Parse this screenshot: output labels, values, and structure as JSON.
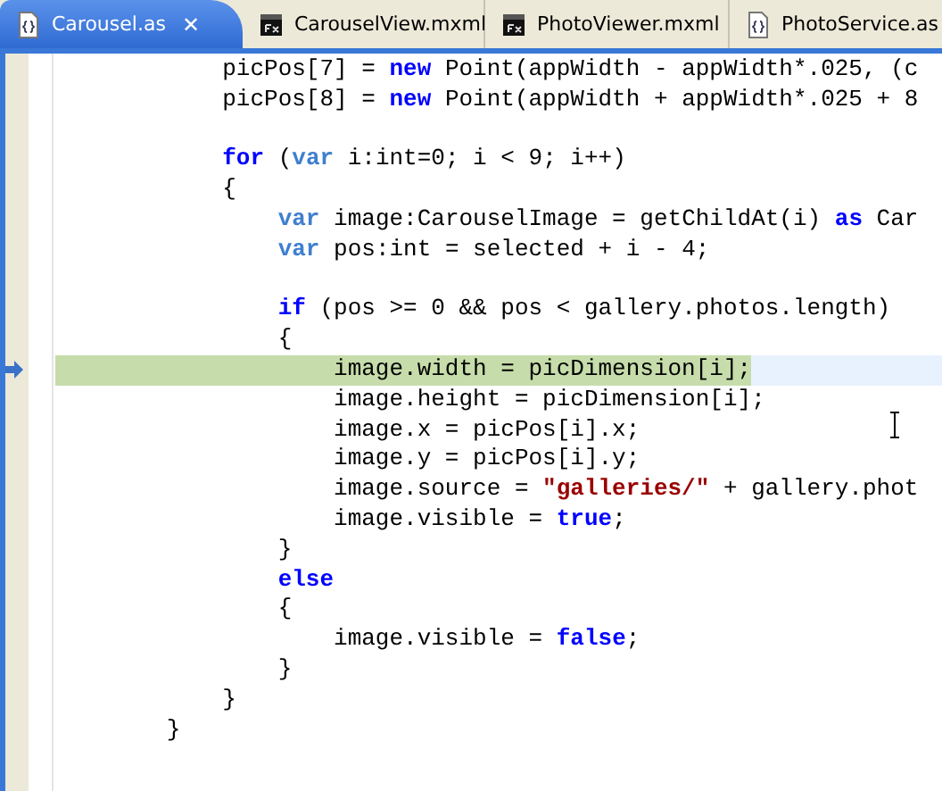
{
  "tabs": [
    {
      "label": "Carousel.as",
      "kind": "as",
      "selected": true,
      "close": "✕"
    },
    {
      "label": "CarouselView.mxml",
      "kind": "mxml",
      "selected": false
    },
    {
      "label": "PhotoViewer.mxml",
      "kind": "mxml",
      "selected": false
    },
    {
      "label": "PhotoService.as",
      "kind": "as",
      "selected": false
    }
  ],
  "editor": {
    "lines": [
      {
        "current": false,
        "segs": [
          {
            "kind": "text",
            "text": "            picPos[7] = "
          },
          {
            "kind": "keyword",
            "text": "new"
          },
          {
            "kind": "text",
            "text": " Point(appWidth - appWidth*.025, (c"
          }
        ]
      },
      {
        "current": false,
        "segs": [
          {
            "kind": "text",
            "text": "            picPos[8] = "
          },
          {
            "kind": "keyword",
            "text": "new"
          },
          {
            "kind": "text",
            "text": " Point(appWidth + appWidth*.025 + 8"
          }
        ]
      },
      {
        "current": false
      },
      {
        "current": false,
        "segs": [
          {
            "kind": "keyword",
            "text": "            for"
          },
          {
            "kind": "text",
            "text": " ("
          },
          {
            "kind": "decl",
            "text": "var"
          },
          {
            "kind": "text",
            "text": " i:int=0; i < 9; i++)"
          }
        ]
      },
      {
        "current": false,
        "segs": [
          {
            "kind": "text",
            "text": "            {"
          }
        ]
      },
      {
        "current": false,
        "segs": [
          {
            "kind": "decl",
            "text": "                var"
          },
          {
            "kind": "text",
            "text": " image:CarouselImage = getChildAt(i) "
          },
          {
            "kind": "keyword",
            "text": "as"
          },
          {
            "kind": "text",
            "text": " Car"
          }
        ]
      },
      {
        "current": false,
        "segs": [
          {
            "kind": "decl",
            "text": "                var"
          },
          {
            "kind": "text",
            "text": " pos:int = selected + i - 4;"
          }
        ]
      },
      {
        "current": false
      },
      {
        "current": false,
        "segs": [
          {
            "kind": "keyword",
            "text": "                if"
          },
          {
            "kind": "text",
            "text": " (pos >= 0 && pos < gallery.photos.length)"
          }
        ]
      },
      {
        "current": false,
        "segs": [
          {
            "kind": "text",
            "text": "                {"
          }
        ]
      },
      {
        "current": true,
        "segs": [
          {
            "kind": "text",
            "text": "                    image.width = picDimension[i];"
          }
        ]
      },
      {
        "current": false,
        "segs": [
          {
            "kind": "text",
            "text": "                    image.height = picDimension[i];"
          }
        ]
      },
      {
        "current": false,
        "segs": [
          {
            "kind": "text",
            "text": "                    image.x = picPos[i].x;"
          }
        ]
      },
      {
        "current": false,
        "segs": [
          {
            "kind": "text",
            "text": "                    image.y = picPos[i].y;"
          }
        ]
      },
      {
        "current": false,
        "segs": [
          {
            "kind": "text",
            "text": "                    image.source = "
          },
          {
            "kind": "string",
            "text": "\"galleries/\""
          },
          {
            "kind": "text",
            "text": " + gallery.phot"
          }
        ]
      },
      {
        "current": false,
        "segs": [
          {
            "kind": "text",
            "text": "                    image.visible = "
          },
          {
            "kind": "keyword",
            "text": "true"
          },
          {
            "kind": "text",
            "text": ";"
          }
        ]
      },
      {
        "current": false,
        "segs": [
          {
            "kind": "text",
            "text": "                }"
          }
        ]
      },
      {
        "current": false,
        "segs": [
          {
            "kind": "keyword",
            "text": "                else"
          }
        ]
      },
      {
        "current": false,
        "segs": [
          {
            "kind": "text",
            "text": "                {"
          }
        ]
      },
      {
        "current": false,
        "segs": [
          {
            "kind": "text",
            "text": "                    image.visible = "
          },
          {
            "kind": "keyword",
            "text": "false"
          },
          {
            "kind": "text",
            "text": ";"
          }
        ]
      },
      {
        "current": false,
        "segs": [
          {
            "kind": "text",
            "text": "                }"
          }
        ]
      },
      {
        "current": false,
        "segs": [
          {
            "kind": "text",
            "text": "            }"
          }
        ]
      },
      {
        "current": false,
        "segs": [
          {
            "kind": "text",
            "text": "        }"
          }
        ]
      }
    ]
  }
}
